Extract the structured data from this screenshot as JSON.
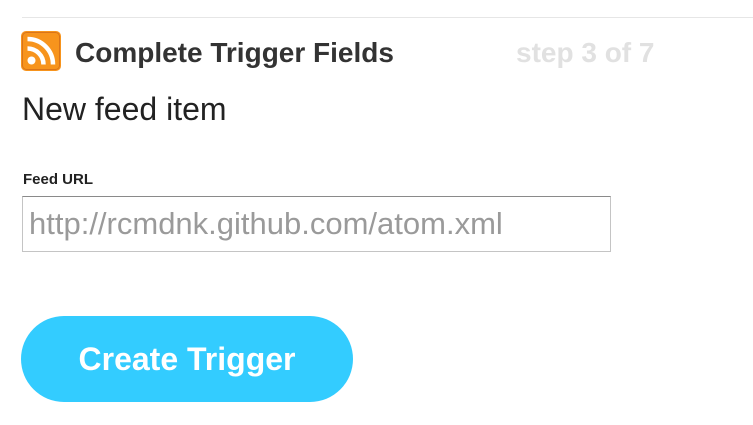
{
  "header": {
    "icon": "rss-feed-icon",
    "icon_color": "#f7941d",
    "title": "Complete Trigger Fields",
    "step_counter": "step 3 of 7"
  },
  "trigger": {
    "name": "New feed item"
  },
  "form": {
    "feed_url_label": "Feed URL",
    "feed_url_placeholder": "http://rcmdnk.github.com/atom.xml",
    "feed_url_value": ""
  },
  "actions": {
    "create_label": "Create Trigger",
    "create_color": "#33ccff"
  }
}
